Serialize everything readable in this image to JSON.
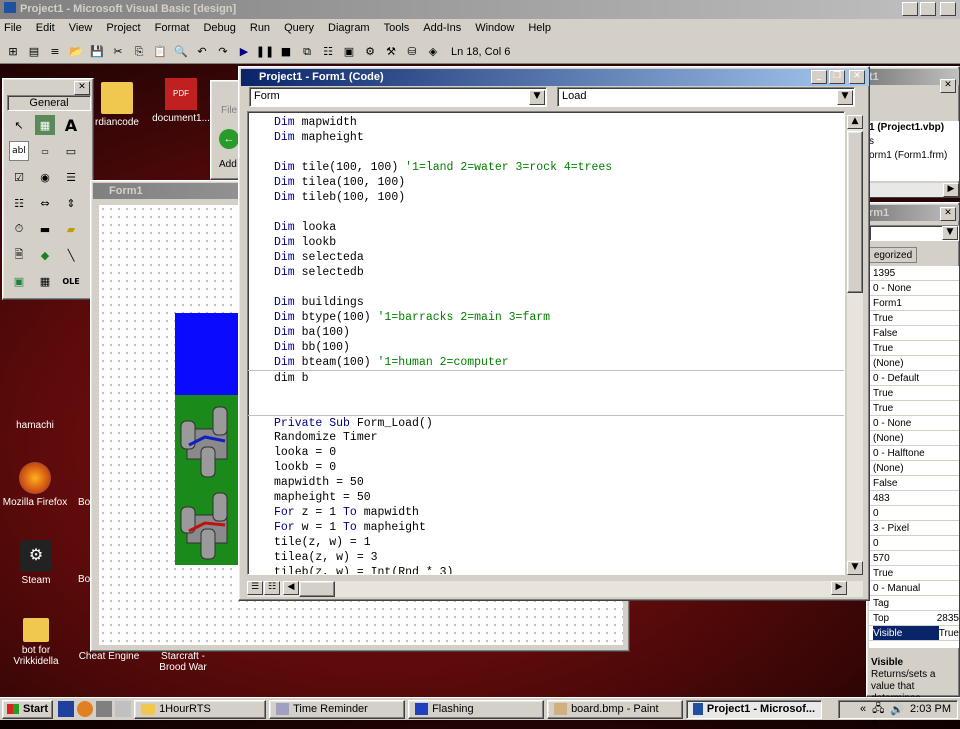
{
  "app": {
    "title": "Project1 - Microsoft Visual Basic [design]"
  },
  "menu": [
    "File",
    "Edit",
    "View",
    "Project",
    "Format",
    "Debug",
    "Run",
    "Query",
    "Diagram",
    "Tools",
    "Add-Ins",
    "Window",
    "Help"
  ],
  "toolbar": {
    "position": "Ln 18, Col 6"
  },
  "desktop": {
    "icons": [
      {
        "label": "rdiancode"
      },
      {
        "label": "document1..."
      },
      {
        "label": "hamachi"
      },
      {
        "label": "Mozilla Firefox"
      },
      {
        "label": "Bo"
      },
      {
        "label": "Steam"
      },
      {
        "label": "Bo"
      },
      {
        "label": "bot for Vrikkidella"
      },
      {
        "label": "Cheat Engine"
      },
      {
        "label": "Starcraft - Brood War"
      }
    ]
  },
  "toolbox": {
    "title": "General"
  },
  "explorer_partial": {
    "file_label": "File",
    "add_label": "Add"
  },
  "form1": {
    "title": "Form1"
  },
  "codewin": {
    "title": "Project1 - Form1 (Code)",
    "object_combo": "Form",
    "proc_combo": "Load",
    "lines": [
      [
        [
          "kw",
          "Dim "
        ],
        [
          "t",
          "mapwidth"
        ]
      ],
      [
        [
          "kw",
          "Dim "
        ],
        [
          "t",
          "mapheight"
        ]
      ],
      [],
      [
        [
          "kw",
          "Dim "
        ],
        [
          "t",
          "tile(100, 100) "
        ],
        [
          "cm",
          "'1=land 2=water 3=rock 4=trees"
        ]
      ],
      [
        [
          "kw",
          "Dim "
        ],
        [
          "t",
          "tilea(100, 100)"
        ]
      ],
      [
        [
          "kw",
          "Dim "
        ],
        [
          "t",
          "tileb(100, 100)"
        ]
      ],
      [],
      [
        [
          "kw",
          "Dim "
        ],
        [
          "t",
          "looka"
        ]
      ],
      [
        [
          "kw",
          "Dim "
        ],
        [
          "t",
          "lookb"
        ]
      ],
      [
        [
          "kw",
          "Dim "
        ],
        [
          "t",
          "selecteda"
        ]
      ],
      [
        [
          "kw",
          "Dim "
        ],
        [
          "t",
          "selectedb"
        ]
      ],
      [],
      [
        [
          "kw",
          "Dim "
        ],
        [
          "t",
          "buildings"
        ]
      ],
      [
        [
          "kw",
          "Dim "
        ],
        [
          "t",
          "btype(100) "
        ],
        [
          "cm",
          "'1=barracks 2=main 3=farm"
        ]
      ],
      [
        [
          "kw",
          "Dim "
        ],
        [
          "t",
          "ba(100)"
        ]
      ],
      [
        [
          "kw",
          "Dim "
        ],
        [
          "t",
          "bb(100)"
        ]
      ],
      [
        [
          "kw",
          "Dim "
        ],
        [
          "t",
          "bteam(100) "
        ],
        [
          "cm",
          "'1=human 2=computer"
        ]
      ],
      [
        [
          "t",
          "dim b"
        ]
      ],
      [],
      [],
      [
        [
          "kw",
          "Private Sub "
        ],
        [
          "t",
          "Form_Load()"
        ]
      ],
      [
        [
          "t",
          "Randomize Timer"
        ]
      ],
      [
        [
          "t",
          "looka = 0"
        ]
      ],
      [
        [
          "t",
          "lookb = 0"
        ]
      ],
      [
        [
          "t",
          "mapwidth = 50"
        ]
      ],
      [
        [
          "t",
          "mapheight = 50"
        ]
      ],
      [
        [
          "kw",
          "For "
        ],
        [
          "t",
          "z = 1 "
        ],
        [
          "kw",
          "To "
        ],
        [
          "t",
          "mapwidth"
        ]
      ],
      [
        [
          "kw",
          "For "
        ],
        [
          "t",
          "w = 1 "
        ],
        [
          "kw",
          "To "
        ],
        [
          "t",
          "mapheight"
        ]
      ],
      [
        [
          "t",
          "tile(z, w) = 1"
        ]
      ],
      [
        [
          "t",
          "tilea(z, w) = 3"
        ]
      ],
      [
        [
          "t",
          "tileb(z, w) = Int(Rnd * 3)"
        ]
      ]
    ]
  },
  "project": {
    "title_frag": "t1",
    "items": [
      "1 (Project1.vbp)",
      "s",
      "orm1 (Form1.frm)"
    ]
  },
  "properties": {
    "title_frag": "rm1",
    "tab": "egorized",
    "rows": [
      {
        "name": "",
        "value": "1395"
      },
      {
        "name": "",
        "value": "0 - None"
      },
      {
        "name": "",
        "value": "Form1"
      },
      {
        "name": "",
        "value": "True"
      },
      {
        "name": "",
        "value": "False"
      },
      {
        "name": "",
        "value": "True"
      },
      {
        "name": "",
        "value": "(None)"
      },
      {
        "name": "",
        "value": "0 - Default"
      },
      {
        "name": "",
        "value": "True"
      },
      {
        "name": "",
        "value": "True"
      },
      {
        "name": "",
        "value": "0 - None"
      },
      {
        "name": "",
        "value": "(None)"
      },
      {
        "name": "",
        "value": "0 - Halftone"
      },
      {
        "name": "",
        "value": "(None)"
      },
      {
        "name": "",
        "value": "False"
      },
      {
        "name": "",
        "value": "483"
      },
      {
        "name": "",
        "value": "0"
      },
      {
        "name": "",
        "value": "3 - Pixel"
      },
      {
        "name": "",
        "value": "0"
      },
      {
        "name": "",
        "value": "570"
      },
      {
        "name": "",
        "value": "True"
      },
      {
        "name": "",
        "value": "0 - Manual"
      },
      {
        "name": "Tag",
        "value": ""
      },
      {
        "name": "Top",
        "value": "2835"
      },
      {
        "name": "Visible",
        "value": "True"
      }
    ],
    "desc_title": "Visible",
    "desc_text": "Returns/sets a value that determines whether an object is"
  },
  "taskbar": {
    "start": "Start",
    "tasks": [
      "1HourRTS",
      "Time Reminder",
      "Flashing",
      "board.bmp - Paint",
      "Project1 - Microsof..."
    ],
    "clock": "2:03 PM"
  }
}
